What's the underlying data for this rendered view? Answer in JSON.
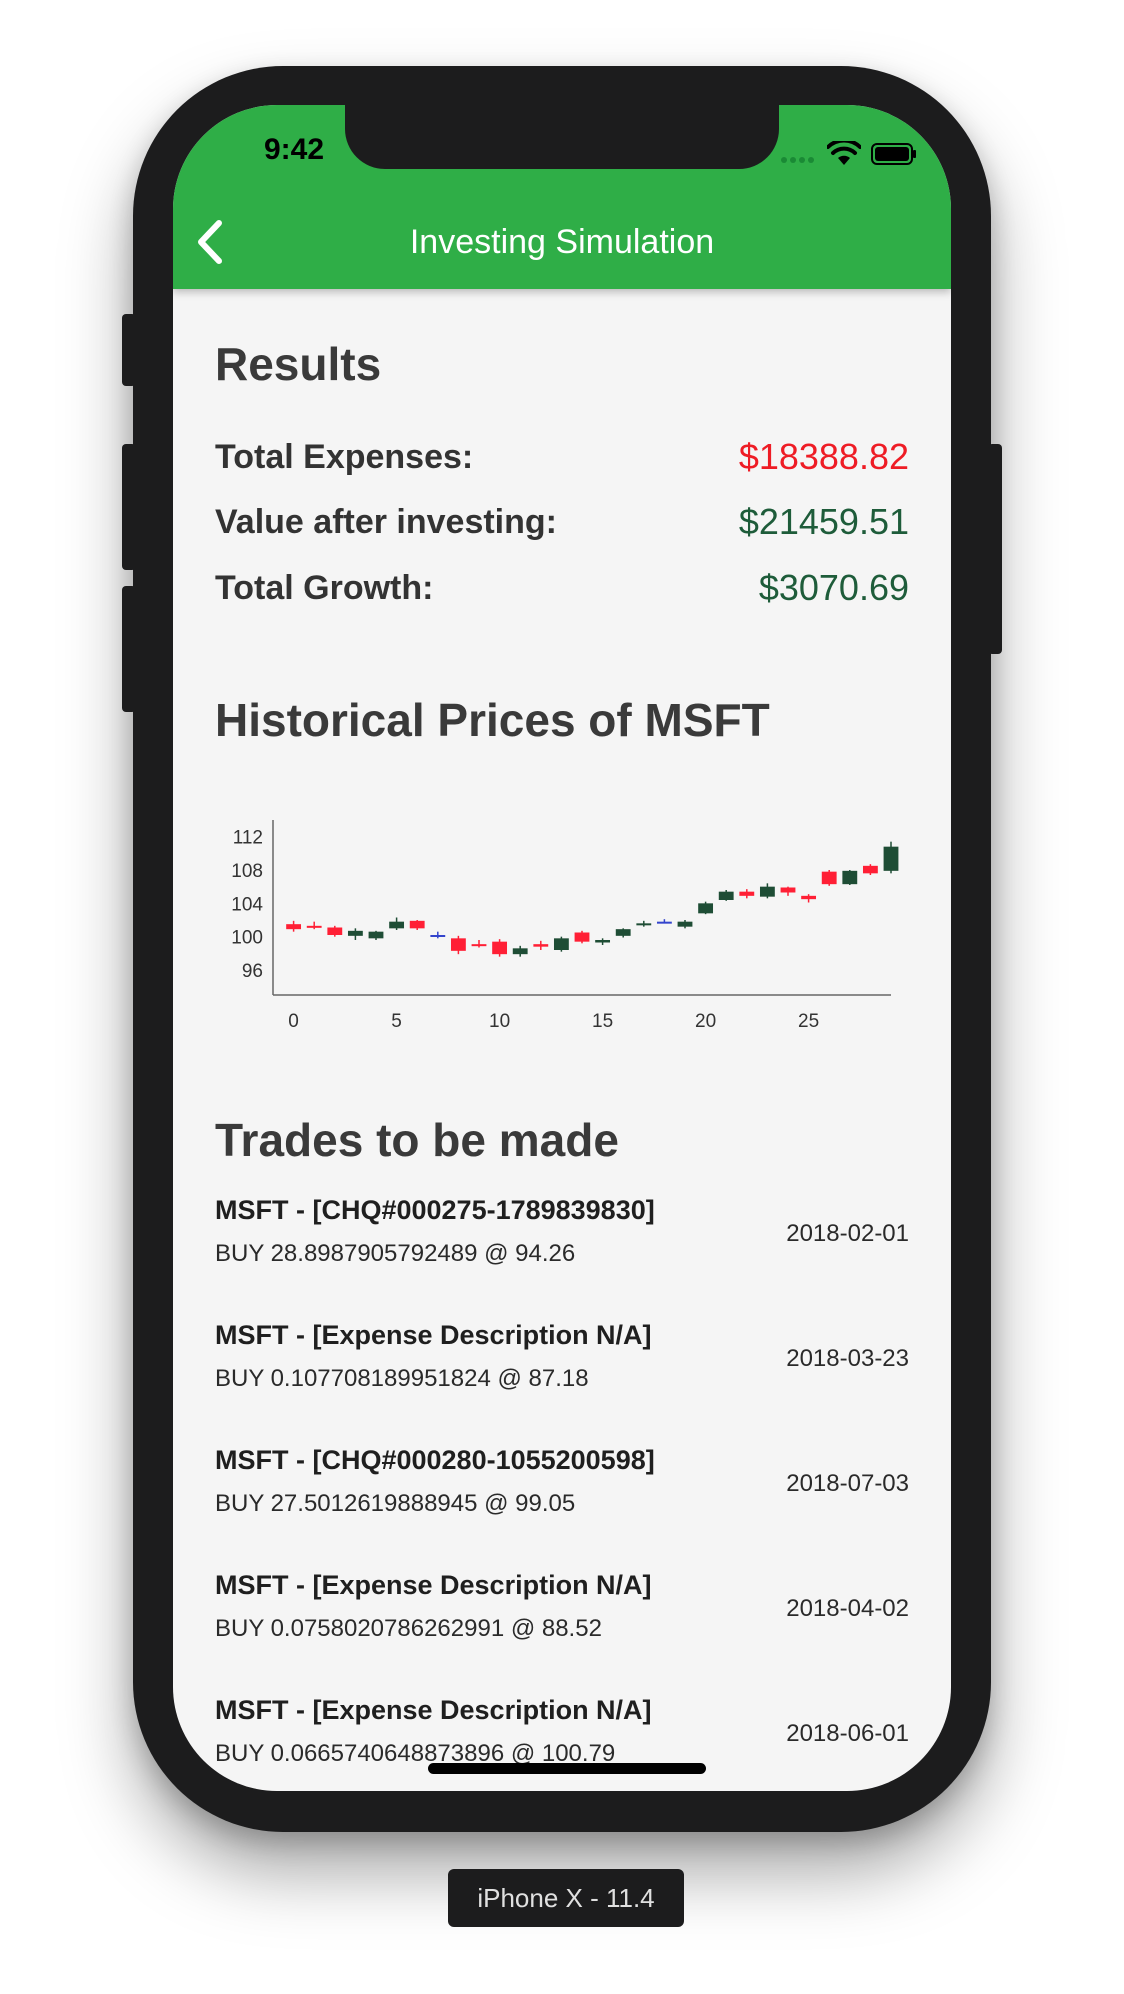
{
  "status_bar": {
    "time": "9:42"
  },
  "app_bar": {
    "title": "Investing Simulation",
    "back_icon": "chevron-left-icon"
  },
  "results": {
    "heading": "Results",
    "rows": [
      {
        "label": "Total Expenses:",
        "value": "$18388.82",
        "color": "#ee1c25"
      },
      {
        "label": "Value after investing:",
        "value": "$21459.51",
        "color": "#1e5c3a"
      },
      {
        "label": "Total Growth:",
        "value": "$3070.69",
        "color": "#1e5c3a"
      }
    ]
  },
  "history": {
    "heading": "Historical Prices of MSFT"
  },
  "chart_data": {
    "type": "candlestick",
    "title": "",
    "xlabel": "",
    "ylabel": "",
    "xlim": [
      -1,
      29
    ],
    "ylim": [
      93,
      114
    ],
    "xticks": [
      0,
      5,
      10,
      15,
      20,
      25
    ],
    "yticks": [
      96,
      100,
      104,
      108,
      112
    ],
    "colors": {
      "up": "#1e4d35",
      "down": "#ff1f35",
      "doji": "#3344cc"
    },
    "candles": [
      {
        "x": 0,
        "open": 101.5,
        "high": 101.9,
        "low": 100.6,
        "close": 100.9
      },
      {
        "x": 1,
        "open": 101.3,
        "high": 101.8,
        "low": 100.9,
        "close": 101.2
      },
      {
        "x": 2,
        "open": 101.1,
        "high": 101.3,
        "low": 100.0,
        "close": 100.2
      },
      {
        "x": 3,
        "open": 100.1,
        "high": 101.0,
        "low": 99.6,
        "close": 100.7
      },
      {
        "x": 4,
        "open": 99.8,
        "high": 100.7,
        "low": 99.6,
        "close": 100.6
      },
      {
        "x": 5,
        "open": 101.0,
        "high": 102.3,
        "low": 100.8,
        "close": 101.8
      },
      {
        "x": 6,
        "open": 101.9,
        "high": 102.0,
        "low": 100.8,
        "close": 101.0
      },
      {
        "x": 7,
        "open": 100.2,
        "high": 100.6,
        "low": 99.8,
        "close": 100.2
      },
      {
        "x": 8,
        "open": 99.8,
        "high": 100.1,
        "low": 97.9,
        "close": 98.3
      },
      {
        "x": 9,
        "open": 99.1,
        "high": 99.6,
        "low": 98.7,
        "close": 99.0
      },
      {
        "x": 10,
        "open": 99.4,
        "high": 99.7,
        "low": 97.6,
        "close": 97.9
      },
      {
        "x": 11,
        "open": 97.9,
        "high": 98.9,
        "low": 97.6,
        "close": 98.6
      },
      {
        "x": 12,
        "open": 99.1,
        "high": 99.5,
        "low": 98.4,
        "close": 98.8
      },
      {
        "x": 13,
        "open": 98.4,
        "high": 100.0,
        "low": 98.2,
        "close": 99.8
      },
      {
        "x": 14,
        "open": 100.5,
        "high": 100.7,
        "low": 99.2,
        "close": 99.4
      },
      {
        "x": 15,
        "open": 99.3,
        "high": 99.8,
        "low": 99.0,
        "close": 99.6
      },
      {
        "x": 16,
        "open": 100.1,
        "high": 101.0,
        "low": 99.9,
        "close": 100.9
      },
      {
        "x": 17,
        "open": 101.4,
        "high": 101.9,
        "low": 101.2,
        "close": 101.6
      },
      {
        "x": 18,
        "open": 101.8,
        "high": 102.1,
        "low": 101.6,
        "close": 101.8
      },
      {
        "x": 19,
        "open": 101.2,
        "high": 102.0,
        "low": 101.0,
        "close": 101.8
      },
      {
        "x": 20,
        "open": 102.8,
        "high": 104.2,
        "low": 102.7,
        "close": 104.0
      },
      {
        "x": 21,
        "open": 104.4,
        "high": 105.6,
        "low": 104.3,
        "close": 105.4
      },
      {
        "x": 22,
        "open": 105.4,
        "high": 105.7,
        "low": 104.6,
        "close": 104.9
      },
      {
        "x": 23,
        "open": 104.8,
        "high": 106.4,
        "low": 104.6,
        "close": 106.0
      },
      {
        "x": 24,
        "open": 105.9,
        "high": 106.0,
        "low": 104.9,
        "close": 105.3
      },
      {
        "x": 25,
        "open": 104.9,
        "high": 105.1,
        "low": 104.1,
        "close": 104.5
      },
      {
        "x": 26,
        "open": 107.8,
        "high": 108.0,
        "low": 106.1,
        "close": 106.3
      },
      {
        "x": 27,
        "open": 106.3,
        "high": 108.0,
        "low": 106.2,
        "close": 107.9
      },
      {
        "x": 28,
        "open": 108.5,
        "high": 108.7,
        "low": 107.4,
        "close": 107.6
      },
      {
        "x": 29,
        "open": 107.9,
        "high": 111.4,
        "low": 107.6,
        "close": 110.8
      }
    ]
  },
  "trades": {
    "heading": "Trades to be made",
    "items": [
      {
        "title": "MSFT - [CHQ#000275-1789839830]",
        "detail": "BUY 28.8987905792489 @ 94.26",
        "date": "2018-02-01"
      },
      {
        "title": "MSFT - [Expense Description N/A]",
        "detail": "BUY 0.107708189951824 @ 87.18",
        "date": "2018-03-23"
      },
      {
        "title": "MSFT - [CHQ#000280-1055200598]",
        "detail": "BUY 27.5012619888945 @ 99.05",
        "date": "2018-07-03"
      },
      {
        "title": "MSFT - [Expense Description N/A]",
        "detail": "BUY 0.0758020786262991 @ 88.52",
        "date": "2018-04-02"
      },
      {
        "title": "MSFT - [Expense Description N/A]",
        "detail": "BUY 0.0665740648873896 @ 100.79",
        "date": "2018-06-01"
      }
    ]
  },
  "device_label": "iPhone X - 11.4"
}
